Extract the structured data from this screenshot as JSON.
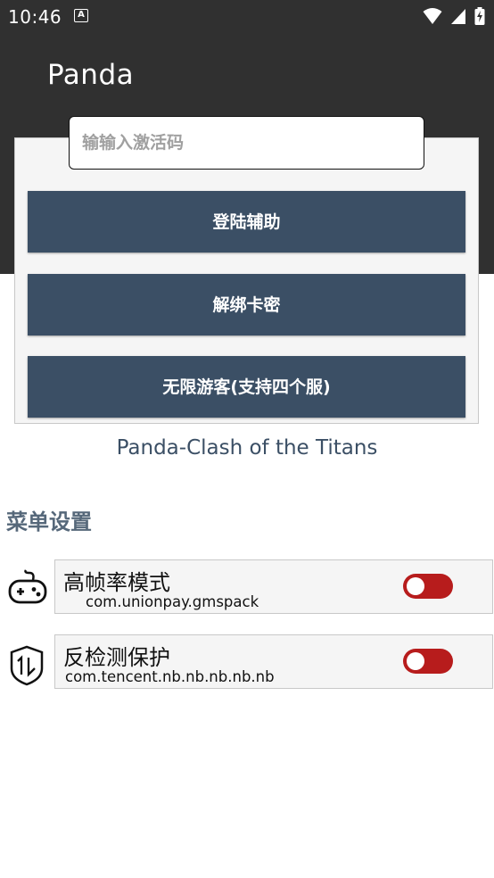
{
  "status_bar": {
    "time": "10:46",
    "notification_glyph": "A",
    "icons": [
      "wifi-icon",
      "signal-icon",
      "battery-charging-icon"
    ]
  },
  "app": {
    "title": "Panda"
  },
  "login_card": {
    "input": {
      "value": "",
      "placeholder": "输输入激活码"
    },
    "buttons": {
      "login": "登陆辅助",
      "unbind": "解绑卡密",
      "guest": "无限游客(支持四个服)"
    }
  },
  "subtitle": "Panda-Clash of the Titans",
  "menu": {
    "section_title": "菜单设置",
    "features": [
      {
        "name": "高帧率模式",
        "package": "com.unionpay.gmspack",
        "icon": "gamepad-icon",
        "enabled": false
      },
      {
        "name": "反检测保护",
        "package": "com.tencent.nb.nb.nb.nb.nb",
        "icon": "shield-icon",
        "enabled": false
      }
    ]
  },
  "colors": {
    "header": "#303030",
    "button": "#3b4f65",
    "toggle_off": "#b71c1c",
    "section_title": "#56687a"
  }
}
